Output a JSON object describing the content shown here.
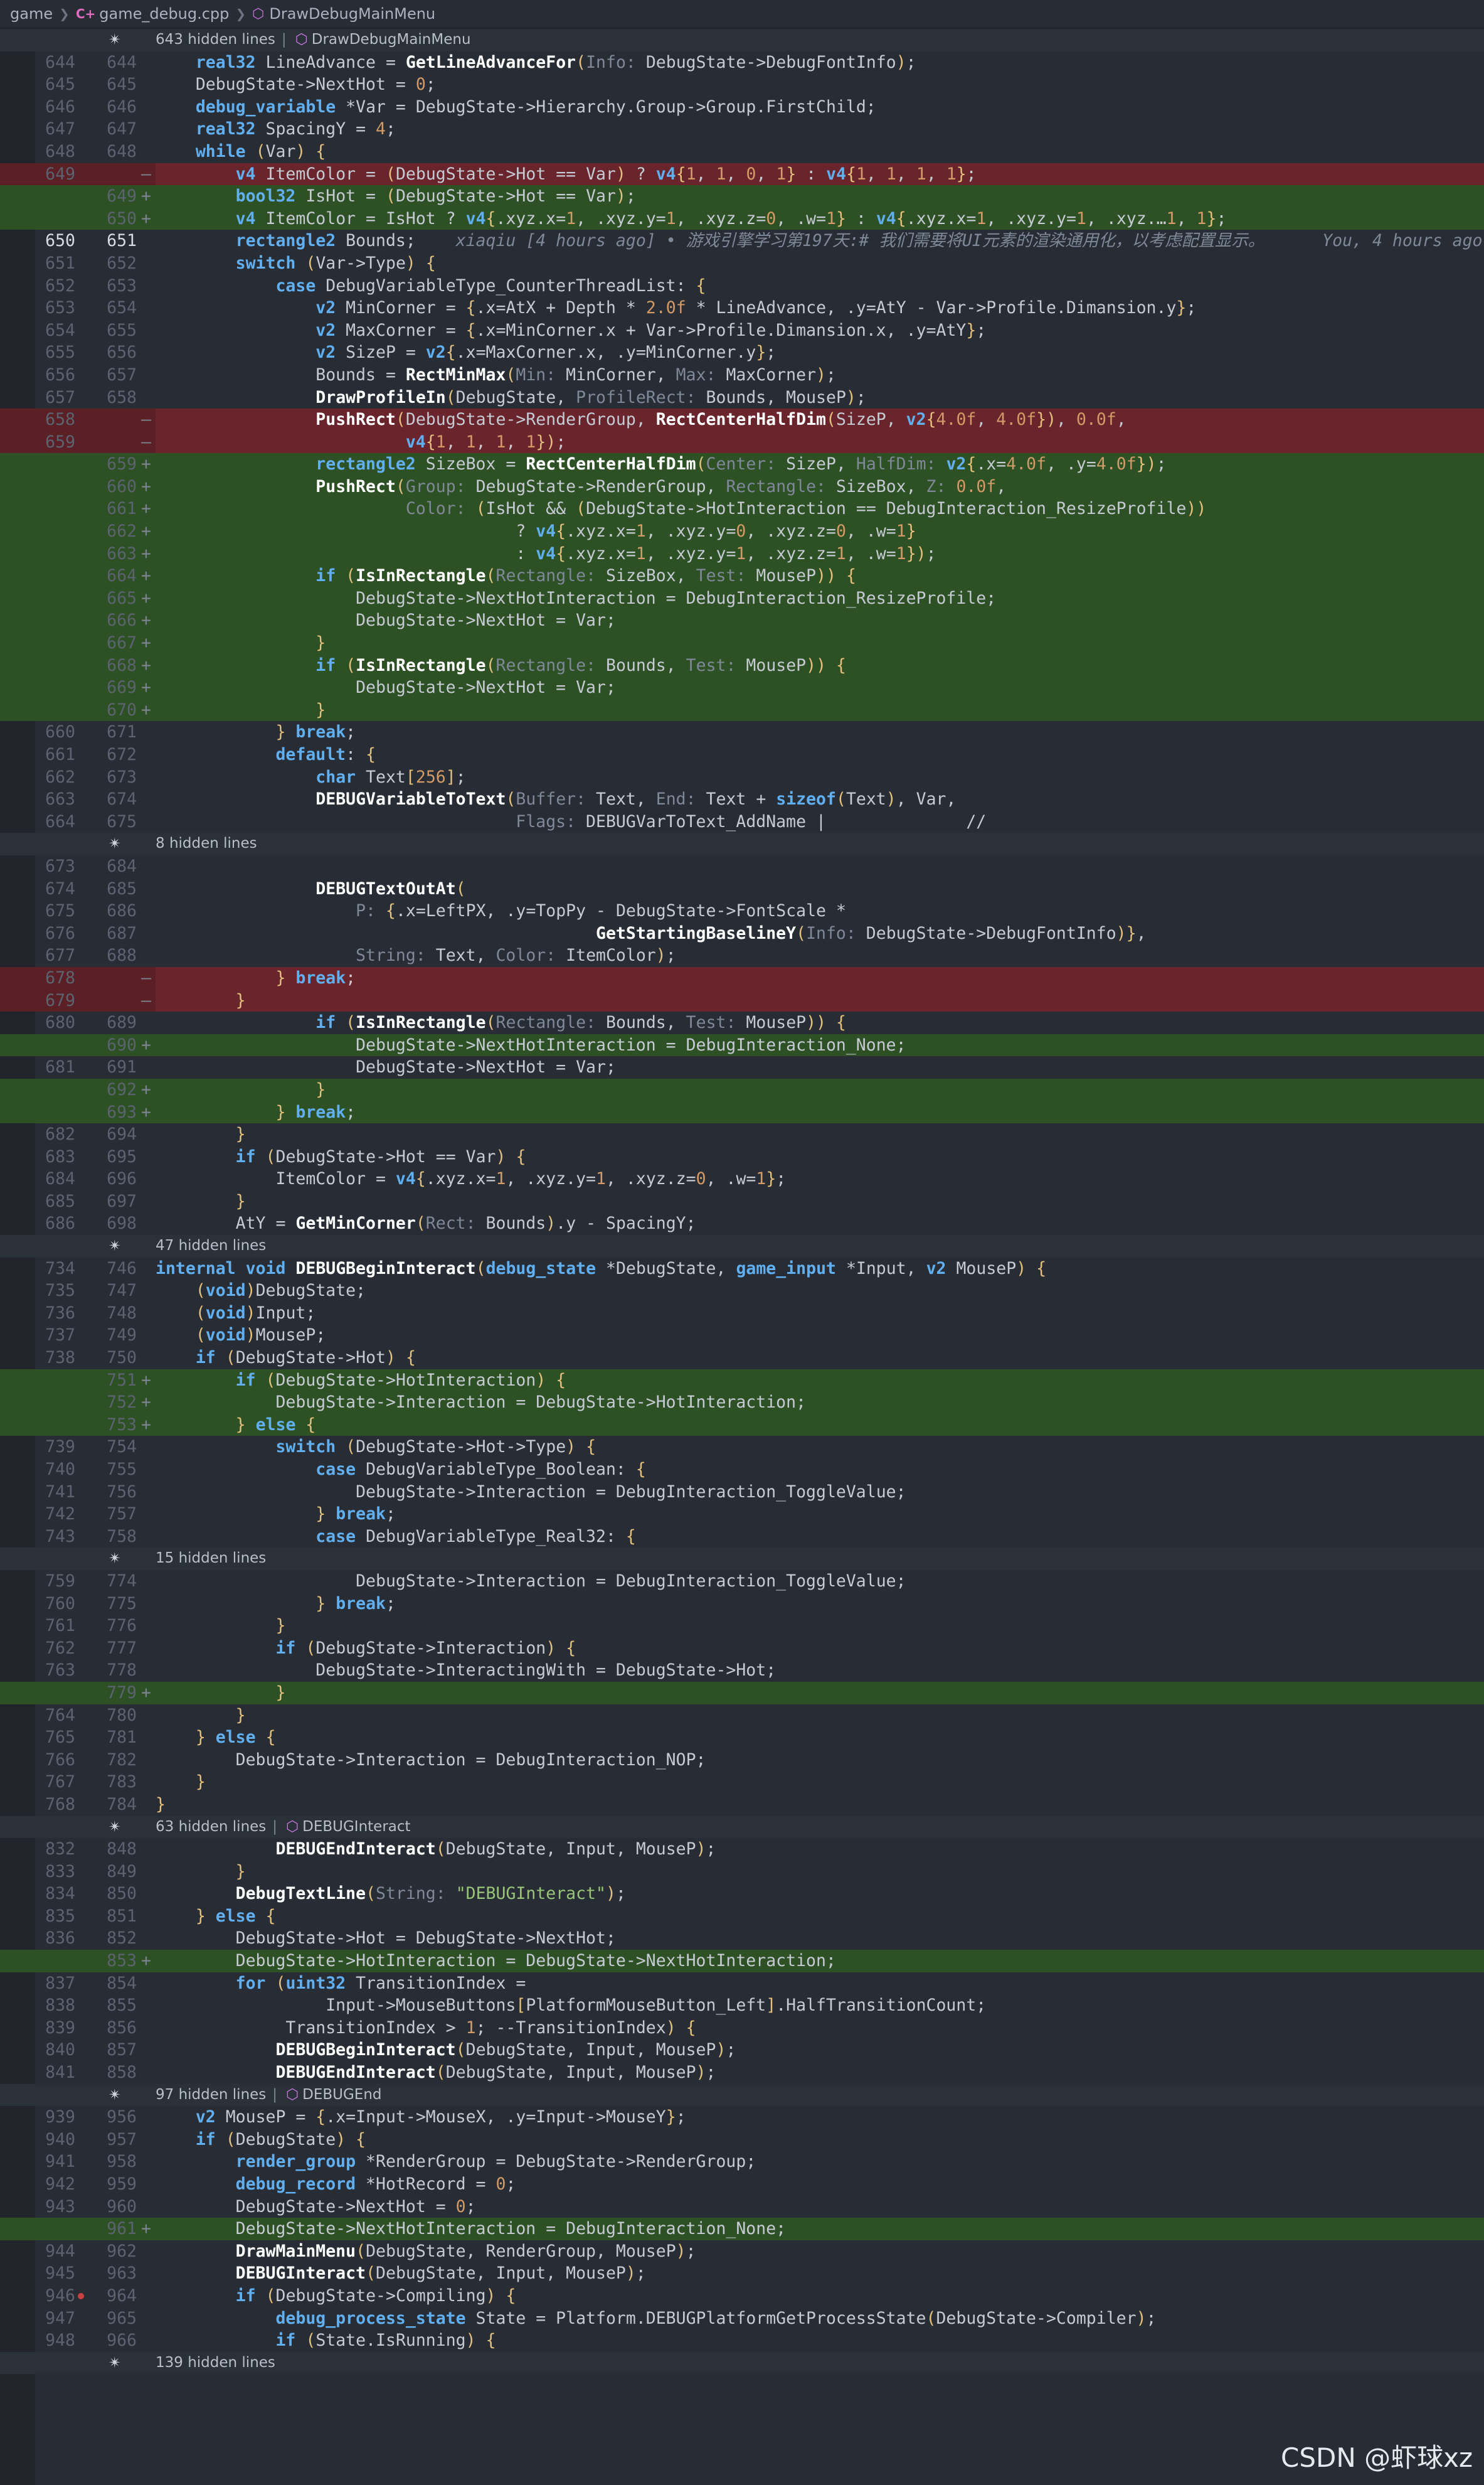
{
  "breadcrumb": {
    "items": [
      "game",
      "game_debug.cpp",
      "DrawDebugMainMenu"
    ],
    "file_icon": "C+",
    "symbol_icon": "cube-icon"
  },
  "blame": {
    "inline": "xiaqiu [4 hours ago] • 游戏引擎学习第197天:# 我们需要将UI元素的渲染通用化，以考虑配置显示。",
    "right": "You, 4 hours ago"
  },
  "watermark": "CSDN @虾球xz",
  "lines": [
    {
      "t": "h",
      "text": "643 hidden lines",
      "sym": "DrawDebugMainMenu"
    },
    {
      "o": "644",
      "n": "644",
      "c": "    real32 LineAdvance = GetLineAdvanceFor(Info: DebugState->DebugFontInfo);"
    },
    {
      "o": "645",
      "n": "645",
      "c": "    DebugState->NextHot = 0;"
    },
    {
      "o": "646",
      "n": "646",
      "c": "    debug_variable *Var = DebugState->Hierarchy.Group->Group.FirstChild;"
    },
    {
      "o": "647",
      "n": "647",
      "c": "    real32 SpacingY = 4;"
    },
    {
      "o": "648",
      "n": "648",
      "c": "    while (Var) {"
    },
    {
      "o": "649",
      "n": "—",
      "k": "del",
      "c": "        v4 ItemColor = (DebugState->Hot == Var) ? v4{1, 1, 0, 1} : v4{1, 1, 1, 1};"
    },
    {
      "o": "",
      "n": "649+",
      "k": "add",
      "c": "        bool32 IsHot = (DebugState->Hot == Var);"
    },
    {
      "o": "",
      "n": "650+",
      "k": "add",
      "c": "        v4 ItemColor = IsHot ? v4{.xyz.x=1, .xyz.y=1, .xyz.z=0, .w=1} : v4{.xyz.x=1, .xyz.y=1, .xyz.…1, 1};"
    },
    {
      "o": "650",
      "n": "651",
      "cur": true,
      "blame": true,
      "c": "        rectangle2 Bounds;    "
    },
    {
      "o": "651",
      "n": "652",
      "c": "        switch (Var->Type) {"
    },
    {
      "o": "652",
      "n": "653",
      "c": "            case DebugVariableType_CounterThreadList: {"
    },
    {
      "o": "653",
      "n": "654",
      "c": "                v2 MinCorner = {.x=AtX + Depth * 2.0f * LineAdvance, .y=AtY - Var->Profile.Dimansion.y};"
    },
    {
      "o": "654",
      "n": "655",
      "c": "                v2 MaxCorner = {.x=MinCorner.x + Var->Profile.Dimansion.x, .y=AtY};"
    },
    {
      "o": "655",
      "n": "656",
      "c": "                v2 SizeP = v2{.x=MaxCorner.x, .y=MinCorner.y};"
    },
    {
      "o": "656",
      "n": "657",
      "c": "                Bounds = RectMinMax(Min: MinCorner, Max: MaxCorner);"
    },
    {
      "o": "657",
      "n": "658",
      "c": "                DrawProfileIn(DebugState, ProfileRect: Bounds, MouseP);"
    },
    {
      "o": "658",
      "n": "—",
      "k": "del",
      "c": "                PushRect(DebugState->RenderGroup, RectCenterHalfDim(SizeP, v2{4.0f, 4.0f}), 0.0f,"
    },
    {
      "o": "659",
      "n": "—",
      "k": "del",
      "c": "                         v4{1, 1, 1, 1});"
    },
    {
      "o": "",
      "n": "659+",
      "k": "add",
      "c": "                rectangle2 SizeBox = RectCenterHalfDim(Center: SizeP, HalfDim: v2{.x=4.0f, .y=4.0f});"
    },
    {
      "o": "",
      "n": "660+",
      "k": "add",
      "c": "                PushRect(Group: DebugState->RenderGroup, Rectangle: SizeBox, Z: 0.0f,"
    },
    {
      "o": "",
      "n": "661+",
      "k": "add",
      "c": "                         Color: (IsHot && (DebugState->HotInteraction == DebugInteraction_ResizeProfile))"
    },
    {
      "o": "",
      "n": "662+",
      "k": "add",
      "c": "                                    ? v4{.xyz.x=1, .xyz.y=0, .xyz.z=0, .w=1}"
    },
    {
      "o": "",
      "n": "663+",
      "k": "add",
      "c": "                                    : v4{.xyz.x=1, .xyz.y=1, .xyz.z=1, .w=1});"
    },
    {
      "o": "",
      "n": "664+",
      "k": "add",
      "c": "                if (IsInRectangle(Rectangle: SizeBox, Test: MouseP)) {"
    },
    {
      "o": "",
      "n": "665+",
      "k": "add",
      "c": "                    DebugState->NextHotInteraction = DebugInteraction_ResizeProfile;"
    },
    {
      "o": "",
      "n": "666+",
      "k": "add",
      "c": "                    DebugState->NextHot = Var;"
    },
    {
      "o": "",
      "n": "667+",
      "k": "add",
      "c": "                }"
    },
    {
      "o": "",
      "n": "668+",
      "k": "add",
      "c": "                if (IsInRectangle(Rectangle: Bounds, Test: MouseP)) {"
    },
    {
      "o": "",
      "n": "669+",
      "k": "add",
      "c": "                    DebugState->NextHot = Var;"
    },
    {
      "o": "",
      "n": "670+",
      "k": "add",
      "c": "                }"
    },
    {
      "o": "660",
      "n": "671",
      "c": "            } break;"
    },
    {
      "o": "661",
      "n": "672",
      "c": "            default: {"
    },
    {
      "o": "662",
      "n": "673",
      "c": "                char Text[256];"
    },
    {
      "o": "663",
      "n": "674",
      "c": "                DEBUGVariableToText(Buffer: Text, End: Text + sizeof(Text), Var,"
    },
    {
      "o": "664",
      "n": "675",
      "c": "                                    Flags: DEBUGVarToText_AddName |              //"
    },
    {
      "t": "h",
      "text": "8 hidden lines",
      "sym": ""
    },
    {
      "o": "673",
      "n": "684",
      "c": "                "
    },
    {
      "o": "674",
      "n": "685",
      "c": "                DEBUGTextOutAt("
    },
    {
      "o": "675",
      "n": "686",
      "c": "                    P: {.x=LeftPX, .y=TopPy - DebugState->FontScale *"
    },
    {
      "o": "676",
      "n": "687",
      "c": "                                            GetStartingBaselineY(Info: DebugState->DebugFontInfo)},"
    },
    {
      "o": "677",
      "n": "688",
      "c": "                    String: Text, Color: ItemColor);"
    },
    {
      "o": "678",
      "n": "—",
      "k": "del",
      "c": "            } break;"
    },
    {
      "o": "679",
      "n": "—",
      "k": "del",
      "c": "        }"
    },
    {
      "o": "680",
      "n": "689",
      "c": "                if (IsInRectangle(Rectangle: Bounds, Test: MouseP)) {"
    },
    {
      "o": "",
      "n": "690+",
      "k": "add",
      "c": "                    DebugState->NextHotInteraction = DebugInteraction_None;"
    },
    {
      "o": "681",
      "n": "691",
      "c": "                    DebugState->NextHot = Var;"
    },
    {
      "o": "",
      "n": "692+",
      "k": "add",
      "c": "                }"
    },
    {
      "o": "",
      "n": "693+",
      "k": "add",
      "c": "            } break;"
    },
    {
      "o": "682",
      "n": "694",
      "c": "        }"
    },
    {
      "o": "683",
      "n": "695",
      "c": "        if (DebugState->Hot == Var) {"
    },
    {
      "o": "684",
      "n": "696",
      "c": "            ItemColor = v4{.xyz.x=1, .xyz.y=1, .xyz.z=0, .w=1};"
    },
    {
      "o": "685",
      "n": "697",
      "c": "        }"
    },
    {
      "o": "686",
      "n": "698",
      "c": "        AtY = GetMinCorner(Rect: Bounds).y - SpacingY;"
    },
    {
      "t": "h",
      "text": "47 hidden lines",
      "sym": ""
    },
    {
      "o": "734",
      "n": "746",
      "c": "internal void DEBUGBeginInteract(debug_state *DebugState, game_input *Input, v2 MouseP) {"
    },
    {
      "o": "735",
      "n": "747",
      "c": "    (void)DebugState;"
    },
    {
      "o": "736",
      "n": "748",
      "c": "    (void)Input;"
    },
    {
      "o": "737",
      "n": "749",
      "c": "    (void)MouseP;"
    },
    {
      "o": "738",
      "n": "750",
      "c": "    if (DebugState->Hot) {"
    },
    {
      "o": "",
      "n": "751+",
      "k": "add",
      "c": "        if (DebugState->HotInteraction) {"
    },
    {
      "o": "",
      "n": "752+",
      "k": "add",
      "c": "            DebugState->Interaction = DebugState->HotInteraction;"
    },
    {
      "o": "",
      "n": "753+",
      "k": "add",
      "c": "        } else {"
    },
    {
      "o": "739",
      "n": "754",
      "c": "            switch (DebugState->Hot->Type) {"
    },
    {
      "o": "740",
      "n": "755",
      "c": "                case DebugVariableType_Boolean: {"
    },
    {
      "o": "741",
      "n": "756",
      "c": "                    DebugState->Interaction = DebugInteraction_ToggleValue;"
    },
    {
      "o": "742",
      "n": "757",
      "c": "                } break;"
    },
    {
      "o": "743",
      "n": "758",
      "c": "                case DebugVariableType_Real32: {"
    },
    {
      "t": "h",
      "text": "15 hidden lines",
      "sym": ""
    },
    {
      "o": "759",
      "n": "774",
      "c": "                    DebugState->Interaction = DebugInteraction_ToggleValue;"
    },
    {
      "o": "760",
      "n": "775",
      "c": "                } break;"
    },
    {
      "o": "761",
      "n": "776",
      "c": "            }"
    },
    {
      "o": "762",
      "n": "777",
      "c": "            if (DebugState->Interaction) {"
    },
    {
      "o": "763",
      "n": "778",
      "c": "                DebugState->InteractingWith = DebugState->Hot;"
    },
    {
      "o": "",
      "n": "779+",
      "k": "add",
      "c": "            }"
    },
    {
      "o": "764",
      "n": "780",
      "c": "        }"
    },
    {
      "o": "765",
      "n": "781",
      "c": "    } else {"
    },
    {
      "o": "766",
      "n": "782",
      "c": "        DebugState->Interaction = DebugInteraction_NOP;"
    },
    {
      "o": "767",
      "n": "783",
      "c": "    }"
    },
    {
      "o": "768",
      "n": "784",
      "c": "}"
    },
    {
      "t": "h",
      "text": "63 hidden lines",
      "sym": "DEBUGInteract"
    },
    {
      "o": "832",
      "n": "848",
      "c": "            DEBUGEndInteract(DebugState, Input, MouseP);"
    },
    {
      "o": "833",
      "n": "849",
      "c": "        }"
    },
    {
      "o": "834",
      "n": "850",
      "c": "        DebugTextLine(String: \"DEBUGInteract\");"
    },
    {
      "o": "835",
      "n": "851",
      "c": "    } else {"
    },
    {
      "o": "836",
      "n": "852",
      "c": "        DebugState->Hot = DebugState->NextHot;"
    },
    {
      "o": "",
      "n": "853+",
      "k": "add",
      "c": "        DebugState->HotInteraction = DebugState->NextHotInteraction;"
    },
    {
      "o": "837",
      "n": "854",
      "c": "        for (uint32 TransitionIndex ="
    },
    {
      "o": "838",
      "n": "855",
      "c": "                 Input->MouseButtons[PlatformMouseButton_Left].HalfTransitionCount;"
    },
    {
      "o": "839",
      "n": "856",
      "c": "             TransitionIndex > 1; --TransitionIndex) {"
    },
    {
      "o": "840",
      "n": "857",
      "c": "            DEBUGBeginInteract(DebugState, Input, MouseP);"
    },
    {
      "o": "841",
      "n": "858",
      "c": "            DEBUGEndInteract(DebugState, Input, MouseP);"
    },
    {
      "t": "h",
      "text": "97 hidden lines",
      "sym": "DEBUGEnd"
    },
    {
      "o": "939",
      "n": "956",
      "c": "    v2 MouseP = {.x=Input->MouseX, .y=Input->MouseY};"
    },
    {
      "o": "940",
      "n": "957",
      "c": "    if (DebugState) {"
    },
    {
      "o": "941",
      "n": "958",
      "c": "        render_group *RenderGroup = DebugState->RenderGroup;"
    },
    {
      "o": "942",
      "n": "959",
      "c": "        debug_record *HotRecord = 0;"
    },
    {
      "o": "943",
      "n": "960",
      "c": "        DebugState->NextHot = 0;"
    },
    {
      "o": "",
      "n": "961+",
      "k": "add",
      "c": "        DebugState->NextHotInteraction = DebugInteraction_None;"
    },
    {
      "o": "944",
      "n": "962",
      "c": "        DrawMainMenu(DebugState, RenderGroup, MouseP);"
    },
    {
      "o": "945",
      "n": "963",
      "c": "        DEBUGInteract(DebugState, Input, MouseP);"
    },
    {
      "o": "946",
      "n": "964",
      "bp": true,
      "c": "        if (DebugState->Compiling) {"
    },
    {
      "o": "947",
      "n": "965",
      "c": "            debug_process_state State = Platform.DEBUGPlatformGetProcessState(DebugState->Compiler);"
    },
    {
      "o": "948",
      "n": "966",
      "c": "            if (State.IsRunning) {"
    },
    {
      "t": "h",
      "text": "139 hidden lines",
      "sym": ""
    }
  ],
  "colors": {
    "background": "#282c34",
    "deleted_line": "#5a2026",
    "added_line": "#2d5124",
    "hidden_bar": "#2b3139",
    "keyword": "#61afef",
    "type": "#56b6c2",
    "number": "#d19a66",
    "string": "#98c379"
  }
}
